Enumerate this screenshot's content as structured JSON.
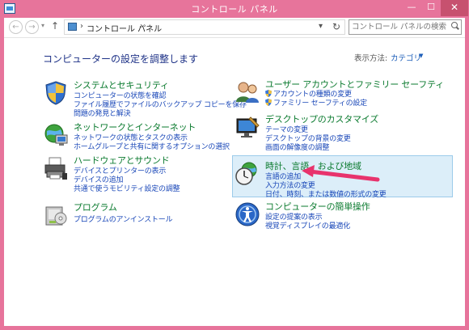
{
  "window": {
    "title": "コントロール パネル",
    "min_glyph": "—",
    "max_glyph": "☐",
    "close_glyph": "✕"
  },
  "nav": {
    "back_glyph": "←",
    "forward_glyph": "→",
    "recent_glyph": "▾",
    "up_glyph": "↑",
    "sep_glyph": "›",
    "breadcrumb": "コントロール パネル",
    "dropdown_glyph": "▾",
    "refresh_glyph": "↻",
    "search_placeholder": "コントロール パネルの検索"
  },
  "header": {
    "title": "コンピューターの設定を調整します",
    "viewby_label": "表示方法:",
    "viewby_value": "カテゴリ",
    "viewby_caret": "▼"
  },
  "categories": [
    {
      "title": "システムとセキュリティ",
      "icon": "shield-icon",
      "links": [
        "コンピューターの状態を確認",
        "ファイル履歴でファイルのバックアップ コピーを保存",
        "問題の発見と解決"
      ]
    },
    {
      "title": "ネットワークとインターネット",
      "icon": "network-globe-icon",
      "links": [
        "ネットワークの状態とタスクの表示",
        "ホームグループと共有に関するオプションの選択"
      ]
    },
    {
      "title": "ハードウェアとサウンド",
      "icon": "printer-icon",
      "links": [
        "デバイスとプリンターの表示",
        "デバイスの追加",
        "共通で使うモビリティ設定の調整"
      ]
    },
    {
      "title": "プログラム",
      "icon": "programs-icon",
      "links": [
        "プログラムのアンインストール"
      ]
    },
    {
      "title": "ユーザー アカウントとファミリー セーフティ",
      "icon": "users-icon",
      "links": [
        "アカウントの種類の変更",
        "ファミリー セーフティの設定"
      ]
    },
    {
      "title": "デスクトップのカスタマイズ",
      "icon": "desktop-icon",
      "links": [
        "テーマの変更",
        "デスクトップの背景の変更",
        "画面の解像度の調整"
      ]
    },
    {
      "title": "時計、言語、および地域",
      "icon": "clock-globe-icon",
      "links": [
        "言語の追加",
        "入力方法の変更",
        "日付、時刻、または数値の形式の変更"
      ]
    },
    {
      "title": "コンピューターの簡単操作",
      "icon": "ease-of-access-icon",
      "links": [
        "設定の提案の表示",
        "視覚ディスプレイの最適化"
      ]
    }
  ],
  "colors": {
    "window_frame": "#e7749b",
    "category_title": "#0a7a2e",
    "link": "#1947b8",
    "page_title": "#1e3287",
    "highlight_bg": "#dceef9",
    "arrow": "#e8336d"
  }
}
